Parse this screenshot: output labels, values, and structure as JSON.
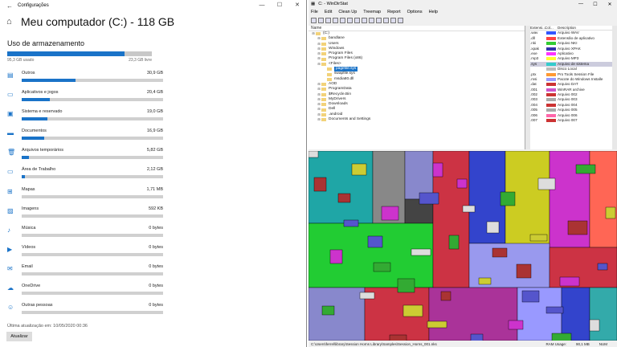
{
  "settings": {
    "title": "Configurações",
    "heading": "Meu computador (C:) - 118 GB",
    "section": "Uso de armazenamento",
    "used": "95,3 GB usado",
    "free": "23,3 GB livre",
    "used_fraction": 0.81,
    "items": [
      {
        "label": "Outros",
        "size": "30,9 GB",
        "fraction": 0.38,
        "icon": "document-icon"
      },
      {
        "label": "Aplicativos e jogos",
        "size": "20,4 GB",
        "fraction": 0.2,
        "icon": "monitor-apps-icon"
      },
      {
        "label": "Sistema e reservado",
        "size": "19,0 GB",
        "fraction": 0.18,
        "icon": "system-icon"
      },
      {
        "label": "Documentos",
        "size": "16,9 GB",
        "fraction": 0.16,
        "icon": "folder-icon"
      },
      {
        "label": "Arquivos temporários",
        "size": "5,82 GB",
        "fraction": 0.05,
        "icon": "trash-icon"
      },
      {
        "label": "Área de Trabalho",
        "size": "2,12 GB",
        "fraction": 0.02,
        "icon": "desktop-icon"
      },
      {
        "label": "Mapas",
        "size": "1,71 MB",
        "fraction": 0.0,
        "icon": "map-icon"
      },
      {
        "label": "Imagens",
        "size": "592 KB",
        "fraction": 0.0,
        "icon": "image-icon"
      },
      {
        "label": "Música",
        "size": "0 bytes",
        "fraction": 0.0,
        "icon": "music-icon"
      },
      {
        "label": "Vídeos",
        "size": "0 bytes",
        "fraction": 0.0,
        "icon": "video-icon"
      },
      {
        "label": "Email",
        "size": "0 bytes",
        "fraction": 0.0,
        "icon": "mail-icon"
      },
      {
        "label": "OneDrive",
        "size": "0 bytes",
        "fraction": 0.0,
        "icon": "cloud-icon"
      },
      {
        "label": "Outras pessoas",
        "size": "0 bytes",
        "fraction": 0.0,
        "icon": "people-icon"
      }
    ],
    "last_update": "Última atualização em: 10/05/2020 00:36",
    "update_button": "Atualizar"
  },
  "windirstat": {
    "title": "C: - WinDirStat",
    "menu": [
      "File",
      "Edit",
      "Clean Up",
      "Treemap",
      "Report",
      "Options",
      "Help"
    ],
    "name_col": "Name",
    "tree": [
      {
        "label": "(C:)",
        "indent": 0
      },
      {
        "label": "bandlane",
        "indent": 1
      },
      {
        "label": "Users",
        "indent": 1
      },
      {
        "label": "Windows",
        "indent": 1
      },
      {
        "label": "Program Files",
        "indent": 1
      },
      {
        "label": "Program Files (x86)",
        "indent": 1
      },
      {
        "label": "<Files>",
        "indent": 1
      },
      {
        "label": "pagefile.sys",
        "indent": 2,
        "selected": true
      },
      {
        "label": "swapfile.sys",
        "indent": 2
      },
      {
        "label": "msdia80.dll",
        "indent": 2
      },
      {
        "label": "AOD",
        "indent": 1
      },
      {
        "label": "ProgramData",
        "indent": 1
      },
      {
        "label": "$Recycle.Bin",
        "indent": 1
      },
      {
        "label": "MyDrivers",
        "indent": 1
      },
      {
        "label": "Downloads",
        "indent": 1
      },
      {
        "label": "Dell",
        "indent": 1
      },
      {
        "label": ".android",
        "indent": 1
      },
      {
        "label": "Documents and Settings",
        "indent": 1
      }
    ],
    "ext_headers": [
      "Extensi...",
      "Col...",
      "Description"
    ],
    "extensions": [
      {
        "ext": ".wav",
        "color": "#3355ff",
        "desc": "Arquivo WAV"
      },
      {
        "ext": ".dll",
        "color": "#ff4444",
        "desc": "Extensão de aplicativo"
      },
      {
        "ext": ".nki",
        "color": "#33cc33",
        "desc": "Arquivo NKI"
      },
      {
        "ext": ".xpak",
        "color": "#3333aa",
        "desc": "Arquivo XPAK"
      },
      {
        "ext": ".exe",
        "color": "#ff33ff",
        "desc": "Aplicativo"
      },
      {
        "ext": ".mp3",
        "color": "#ffff33",
        "desc": "Arquivo MP3"
      },
      {
        "ext": ".sys",
        "color": "#33cccc",
        "desc": "Arquivo de sistema",
        "selected": true
      },
      {
        "ext": "",
        "color": "#bbbbbb",
        "desc": "Disco Local"
      },
      {
        "ext": ".ptx",
        "color": "#ff9933",
        "desc": "Pro Tools Session File"
      },
      {
        "ext": ".msi",
        "color": "#9999ff",
        "desc": "Pacote do Windows Installe"
      },
      {
        "ext": ".dat",
        "color": "#cc3333",
        "desc": "Arquivo DAT"
      },
      {
        "ext": ".001",
        "color": "#cc55cc",
        "desc": "WinRAR archive"
      },
      {
        "ext": ".002",
        "color": "#cc3333",
        "desc": "Arquivo 002"
      },
      {
        "ext": ".003",
        "color": "#aaaaaa",
        "desc": "Arquivo 003"
      },
      {
        "ext": ".004",
        "color": "#cc3333",
        "desc": "Arquivo 004"
      },
      {
        "ext": ".005",
        "color": "#aaaaaa",
        "desc": "Arquivo 005"
      },
      {
        "ext": ".006",
        "color": "#ff66aa",
        "desc": "Arquivo 006"
      },
      {
        "ext": ".007",
        "color": "#cc3333",
        "desc": "Arquivo 007"
      }
    ],
    "status_path": "C:\\Users\\ferrel\\library\\Session Horns Library\\Samples\\Session_Horns_001.nks",
    "ram_label": "RAM Usage:",
    "ram_value": "90,1 MB",
    "num": "NUM"
  }
}
